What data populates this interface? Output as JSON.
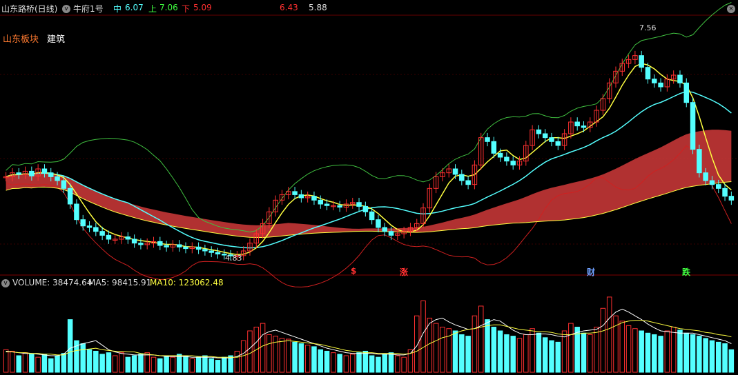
{
  "header": {
    "title": "山东路桥(日线)",
    "indicator": "牛府1号",
    "mid_label": "中",
    "mid_value": "6.07",
    "up_label": "上",
    "up_value": "7.06",
    "down_label": "下",
    "down_value": "5.09",
    "extra_a": "6.43",
    "extra_b": "5.88"
  },
  "tags": {
    "region": "山东板块",
    "industry": "建筑"
  },
  "colors": {
    "bg": "#000000",
    "up": "#ff3030",
    "down": "#54ffff",
    "mid": "#ffff40",
    "upper_band": "#40c040",
    "lower_band": "#d02020",
    "cloud_red": "#d03a3a",
    "cloud_teal": "#1a8a7a",
    "purple": "#c040c0",
    "navy": "#2030a0"
  },
  "price_annotations": {
    "high": "7.56",
    "low": "4.83"
  },
  "event_markers": [
    {
      "text": "$",
      "color": "#ff3030"
    },
    {
      "text": "涨",
      "color": "#ff3030"
    },
    {
      "text": "财",
      "color": "#6fa0ff"
    },
    {
      "text": "跌",
      "color": "#40ff40"
    }
  ],
  "volume_panel": {
    "label": "VOLUME: 38474.64",
    "ma5": "MA5: 98415.91",
    "ma10": "MA10: 123062.48"
  },
  "chart_data": {
    "type": "candlestick",
    "price_range": [
      4.6,
      7.9
    ],
    "closes": [
      5.85,
      5.9,
      5.88,
      5.92,
      5.86,
      5.95,
      5.9,
      5.85,
      5.8,
      5.7,
      5.5,
      5.3,
      5.22,
      5.2,
      5.15,
      5.1,
      5.05,
      5.05,
      5.08,
      5.05,
      5.0,
      4.98,
      5.0,
      5.02,
      4.97,
      4.95,
      4.98,
      4.95,
      4.93,
      4.95,
      4.92,
      4.9,
      4.88,
      4.86,
      4.85,
      4.84,
      4.84,
      4.9,
      5.0,
      5.12,
      5.25,
      5.4,
      5.55,
      5.62,
      5.66,
      5.62,
      5.58,
      5.6,
      5.55,
      5.5,
      5.48,
      5.48,
      5.46,
      5.5,
      5.52,
      5.47,
      5.4,
      5.3,
      5.2,
      5.15,
      5.1,
      5.12,
      5.15,
      5.2,
      5.25,
      5.45,
      5.7,
      5.85,
      5.9,
      5.95,
      5.88,
      5.8,
      5.75,
      6.0,
      6.35,
      6.3,
      6.15,
      6.1,
      6.05,
      6.0,
      6.05,
      6.25,
      6.45,
      6.4,
      6.35,
      6.3,
      6.25,
      6.4,
      6.55,
      6.5,
      6.48,
      6.55,
      6.7,
      6.85,
      7.05,
      7.2,
      7.3,
      7.35,
      7.4,
      7.25,
      7.1,
      7.05,
      7.0,
      7.1,
      7.15,
      7.05,
      6.8,
      6.2,
      5.9,
      5.8,
      5.75,
      5.7,
      5.6,
      5.55
    ],
    "volume": [
      30,
      28,
      22,
      26,
      24,
      20,
      24,
      18,
      22,
      25,
      70,
      42,
      38,
      30,
      28,
      24,
      26,
      22,
      26,
      20,
      22,
      24,
      26,
      20,
      18,
      22,
      20,
      24,
      22,
      18,
      20,
      22,
      18,
      16,
      20,
      22,
      28,
      42,
      55,
      60,
      65,
      50,
      48,
      45,
      44,
      40,
      38,
      36,
      34,
      30,
      28,
      26,
      24,
      22,
      24,
      26,
      28,
      22,
      20,
      24,
      26,
      22,
      20,
      30,
      75,
      95,
      72,
      65,
      60,
      58,
      55,
      50,
      48,
      75,
      88,
      70,
      60,
      55,
      50,
      48,
      45,
      50,
      58,
      52,
      46,
      42,
      40,
      55,
      65,
      60,
      52,
      50,
      60,
      85,
      100,
      75,
      68,
      62,
      58,
      55,
      52,
      50,
      48,
      55,
      60,
      56,
      52,
      50,
      48,
      45,
      42,
      40,
      38,
      30
    ],
    "volume_ma5": [
      28,
      27,
      26,
      25,
      25,
      24,
      23,
      22,
      22,
      24,
      32,
      35,
      38,
      40,
      42,
      36,
      30,
      27,
      25,
      24,
      23,
      23,
      23,
      23,
      22,
      21,
      21,
      21,
      21,
      20,
      20,
      20,
      20,
      19,
      19,
      19,
      21,
      25,
      32,
      40,
      50,
      54,
      56,
      53,
      50,
      47,
      44,
      41,
      38,
      35,
      32,
      30,
      28,
      26,
      25,
      25,
      25,
      25,
      24,
      24,
      24,
      23,
      23,
      25,
      35,
      52,
      65,
      70,
      72,
      67,
      63,
      60,
      57,
      58,
      62,
      66,
      70,
      68,
      62,
      56,
      52,
      50,
      50,
      51,
      51,
      50,
      48,
      47,
      50,
      53,
      55,
      56,
      57,
      62,
      72,
      80,
      84,
      80,
      75,
      70,
      64,
      59,
      55,
      54,
      53,
      52,
      52,
      52,
      50,
      48,
      46,
      44,
      42,
      38
    ],
    "volume_ma10": [
      27,
      27,
      26,
      26,
      25,
      25,
      24,
      24,
      23,
      23,
      27,
      29,
      30,
      31,
      32,
      30,
      29,
      28,
      28,
      27,
      27,
      25,
      24,
      23,
      22,
      22,
      22,
      22,
      22,
      22,
      21,
      21,
      21,
      20,
      20,
      20,
      20,
      22,
      25,
      30,
      35,
      38,
      40,
      41,
      42,
      41,
      40,
      39,
      38,
      37,
      35,
      33,
      31,
      29,
      28,
      27,
      26,
      26,
      25,
      25,
      25,
      25,
      24,
      25,
      28,
      33,
      38,
      42,
      46,
      48,
      52,
      55,
      57,
      58,
      60,
      62,
      63,
      63,
      61,
      59,
      57,
      56,
      55,
      54,
      54,
      53,
      51,
      50,
      50,
      51,
      52,
      52,
      53,
      55,
      58,
      62,
      66,
      68,
      69,
      69,
      68,
      66,
      64,
      62,
      60,
      58,
      57,
      56,
      55,
      53,
      52,
      50,
      49,
      47
    ]
  }
}
